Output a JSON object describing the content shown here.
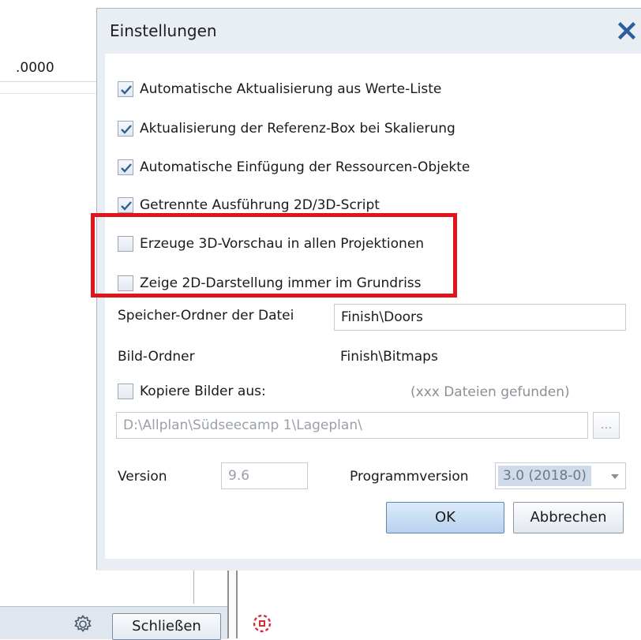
{
  "background": {
    "field_value": ".0000",
    "close_button_label": "Schließen"
  },
  "dialog": {
    "title": "Einstellungen",
    "checkboxes": [
      {
        "label": "Automatische Aktualisierung aus Werte-Liste",
        "checked": true
      },
      {
        "label": "Aktualisierung der Referenz-Box bei Skalierung",
        "checked": true
      },
      {
        "label": "Automatische Einfügung der Ressourcen-Objekte",
        "checked": true
      },
      {
        "label": "Getrennte Ausführung 2D/3D-Script",
        "checked": true
      },
      {
        "label": "Erzeuge 3D-Vorschau in allen Projektionen",
        "checked": false
      },
      {
        "label": "Zeige 2D-Darstellung immer im Grundriss",
        "checked": false
      }
    ],
    "save_folder": {
      "label": "Speicher-Ordner der Datei",
      "value": "Finish\\Doors"
    },
    "image_folder": {
      "label": "Bild-Ordner",
      "value": "Finish\\Bitmaps"
    },
    "copy_images": {
      "label": "Kopiere Bilder aus:",
      "checked": false,
      "status": "(xxx Dateien gefunden)"
    },
    "path": {
      "value": "D:\\Allplan\\Südseecamp 1\\Lageplan\\",
      "browse_label": "..."
    },
    "version": {
      "label": "Version",
      "value": "9.6"
    },
    "program_version": {
      "label": "Programmversion",
      "value": "3.0 (2018-0)"
    },
    "ok_label": "OK",
    "cancel_label": "Abbrechen"
  },
  "colors": {
    "highlight": "#e0141b",
    "check_mark": "#2d5f99",
    "dialog_frame": "#e9eef5"
  }
}
